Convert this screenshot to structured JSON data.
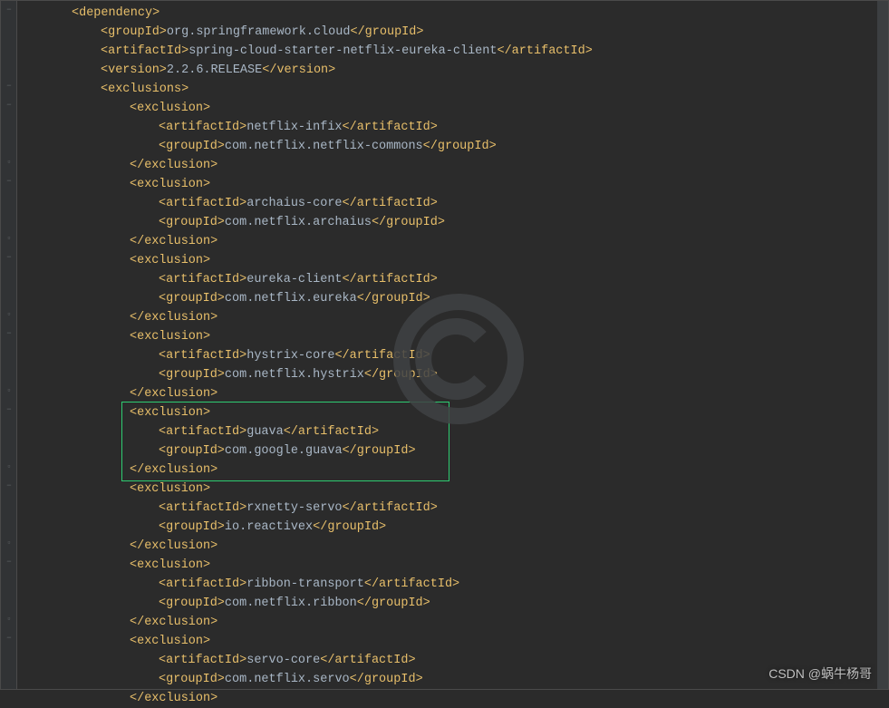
{
  "groupId": "org.springframework.cloud",
  "artifactId": "spring-cloud-starter-netflix-eureka-client",
  "version": "2.2.6.RELEASE",
  "exclusions": [
    {
      "artifactId": "netflix-infix",
      "groupId": "com.netflix.netflix-commons"
    },
    {
      "artifactId": "archaius-core",
      "groupId": "com.netflix.archaius"
    },
    {
      "artifactId": "eureka-client",
      "groupId": "com.netflix.eureka"
    },
    {
      "artifactId": "hystrix-core",
      "groupId": "com.netflix.hystrix"
    },
    {
      "artifactId": "guava",
      "groupId": "com.google.guava"
    },
    {
      "artifactId": "rxnetty-servo",
      "groupId": "io.reactivex"
    },
    {
      "artifactId": "ribbon-transport",
      "groupId": "com.netflix.ribbon"
    },
    {
      "artifactId": "servo-core",
      "groupId": "com.netflix.servo"
    }
  ],
  "tags": {
    "dependency_open": "<dependency>",
    "groupId_open": "<groupId>",
    "groupId_close": "</groupId>",
    "artifactId_open": "<artifactId>",
    "artifactId_close": "</artifactId>",
    "version_open": "<version>",
    "version_close": "</version>",
    "exclusions_open": "<exclusions>",
    "exclusion_open": "<exclusion>",
    "exclusion_close": "</exclusion>"
  },
  "highlighted_index": 4,
  "watermark_text": "CSDN @蜗牛杨哥"
}
